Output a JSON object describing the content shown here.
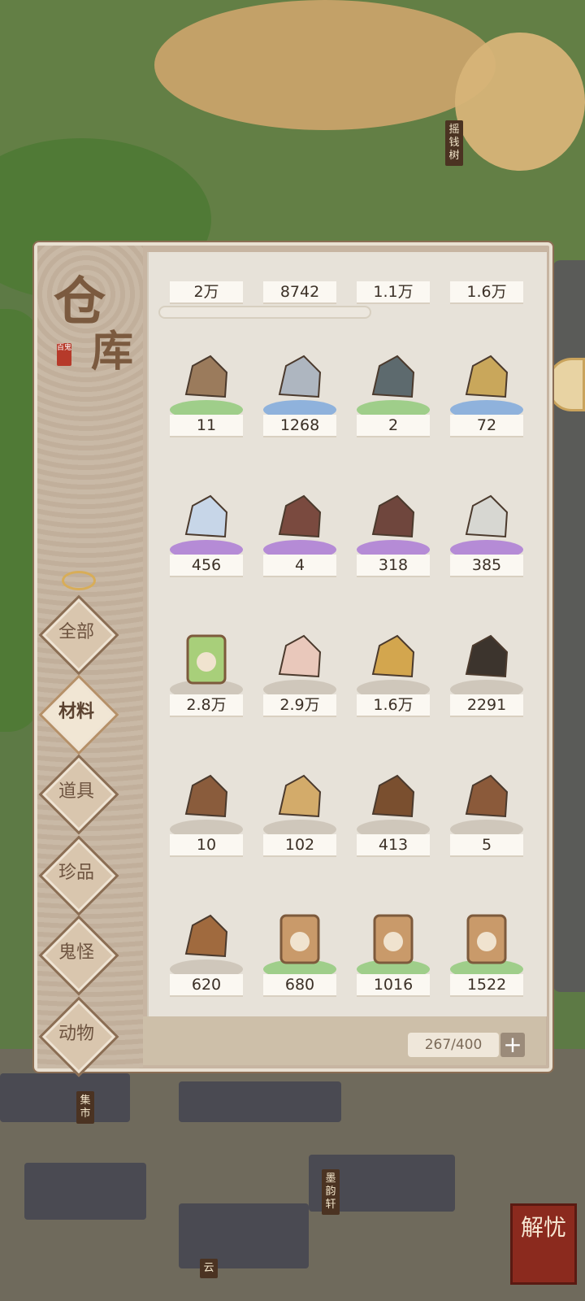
{
  "map": {
    "signs": [
      "摇钱树",
      "集市",
      "墨韵轩",
      "云"
    ],
    "badge": "解忧"
  },
  "warehouse": {
    "title_chars": [
      "仓",
      "库"
    ],
    "seal": "百鬼",
    "tabs": [
      {
        "label": "全部",
        "active": false
      },
      {
        "label": "材料",
        "active": true
      },
      {
        "label": "道具",
        "active": false
      },
      {
        "label": "珍品",
        "active": false
      },
      {
        "label": "鬼怪",
        "active": false
      },
      {
        "label": "动物",
        "active": false
      }
    ],
    "partial_row": [
      "2万",
      "8742",
      "1.1万",
      "1.6万"
    ],
    "rows": [
      [
        {
          "icon": "wooden-ladder-icon",
          "count": "11",
          "rarity": "green"
        },
        {
          "icon": "stone-blocks-icon",
          "count": "1268",
          "rarity": "blue"
        },
        {
          "icon": "dark-ore-icon",
          "count": "2",
          "rarity": "green"
        },
        {
          "icon": "gold-ore-icon",
          "count": "72",
          "rarity": "blue"
        }
      ],
      [
        {
          "icon": "crystal-ore-icon",
          "count": "456",
          "rarity": "purple"
        },
        {
          "icon": "red-ore-icon",
          "count": "4",
          "rarity": "purple"
        },
        {
          "icon": "red-brick-icon",
          "count": "318",
          "rarity": "purple"
        },
        {
          "icon": "white-block-icon",
          "count": "385",
          "rarity": "purple"
        }
      ],
      [
        {
          "icon": "cabbage-icon",
          "count": "2.8万",
          "rarity": "grey"
        },
        {
          "icon": "taro-pieces-icon",
          "count": "2.9万",
          "rarity": "grey"
        },
        {
          "icon": "ginger-icon",
          "count": "1.6万",
          "rarity": "grey"
        },
        {
          "icon": "dark-bark-icon",
          "count": "2291",
          "rarity": "grey"
        }
      ],
      [
        {
          "icon": "yam-icon",
          "count": "10",
          "rarity": "grey"
        },
        {
          "icon": "dried-root-icon",
          "count": "102",
          "rarity": "grey"
        },
        {
          "icon": "tea-leaves-icon",
          "count": "413",
          "rarity": "grey"
        },
        {
          "icon": "ginseng-root-icon",
          "count": "5",
          "rarity": "grey"
        }
      ],
      [
        {
          "icon": "lingzhi-mushroom-icon",
          "count": "620",
          "rarity": "grey"
        },
        {
          "icon": "wheat-seed-bag-icon",
          "count": "680",
          "rarity": "green"
        },
        {
          "icon": "cabbage-seed-bag-icon",
          "count": "1016",
          "rarity": "green"
        },
        {
          "icon": "flower-seed-bag-icon",
          "count": "1522",
          "rarity": "green"
        }
      ]
    ],
    "capacity": "267/400",
    "add_label": "+",
    "colors": {
      "green": "#9fce8a",
      "blue": "#8fb2dc",
      "purple": "#b58bd6",
      "grey": "#cfc7bb"
    }
  }
}
